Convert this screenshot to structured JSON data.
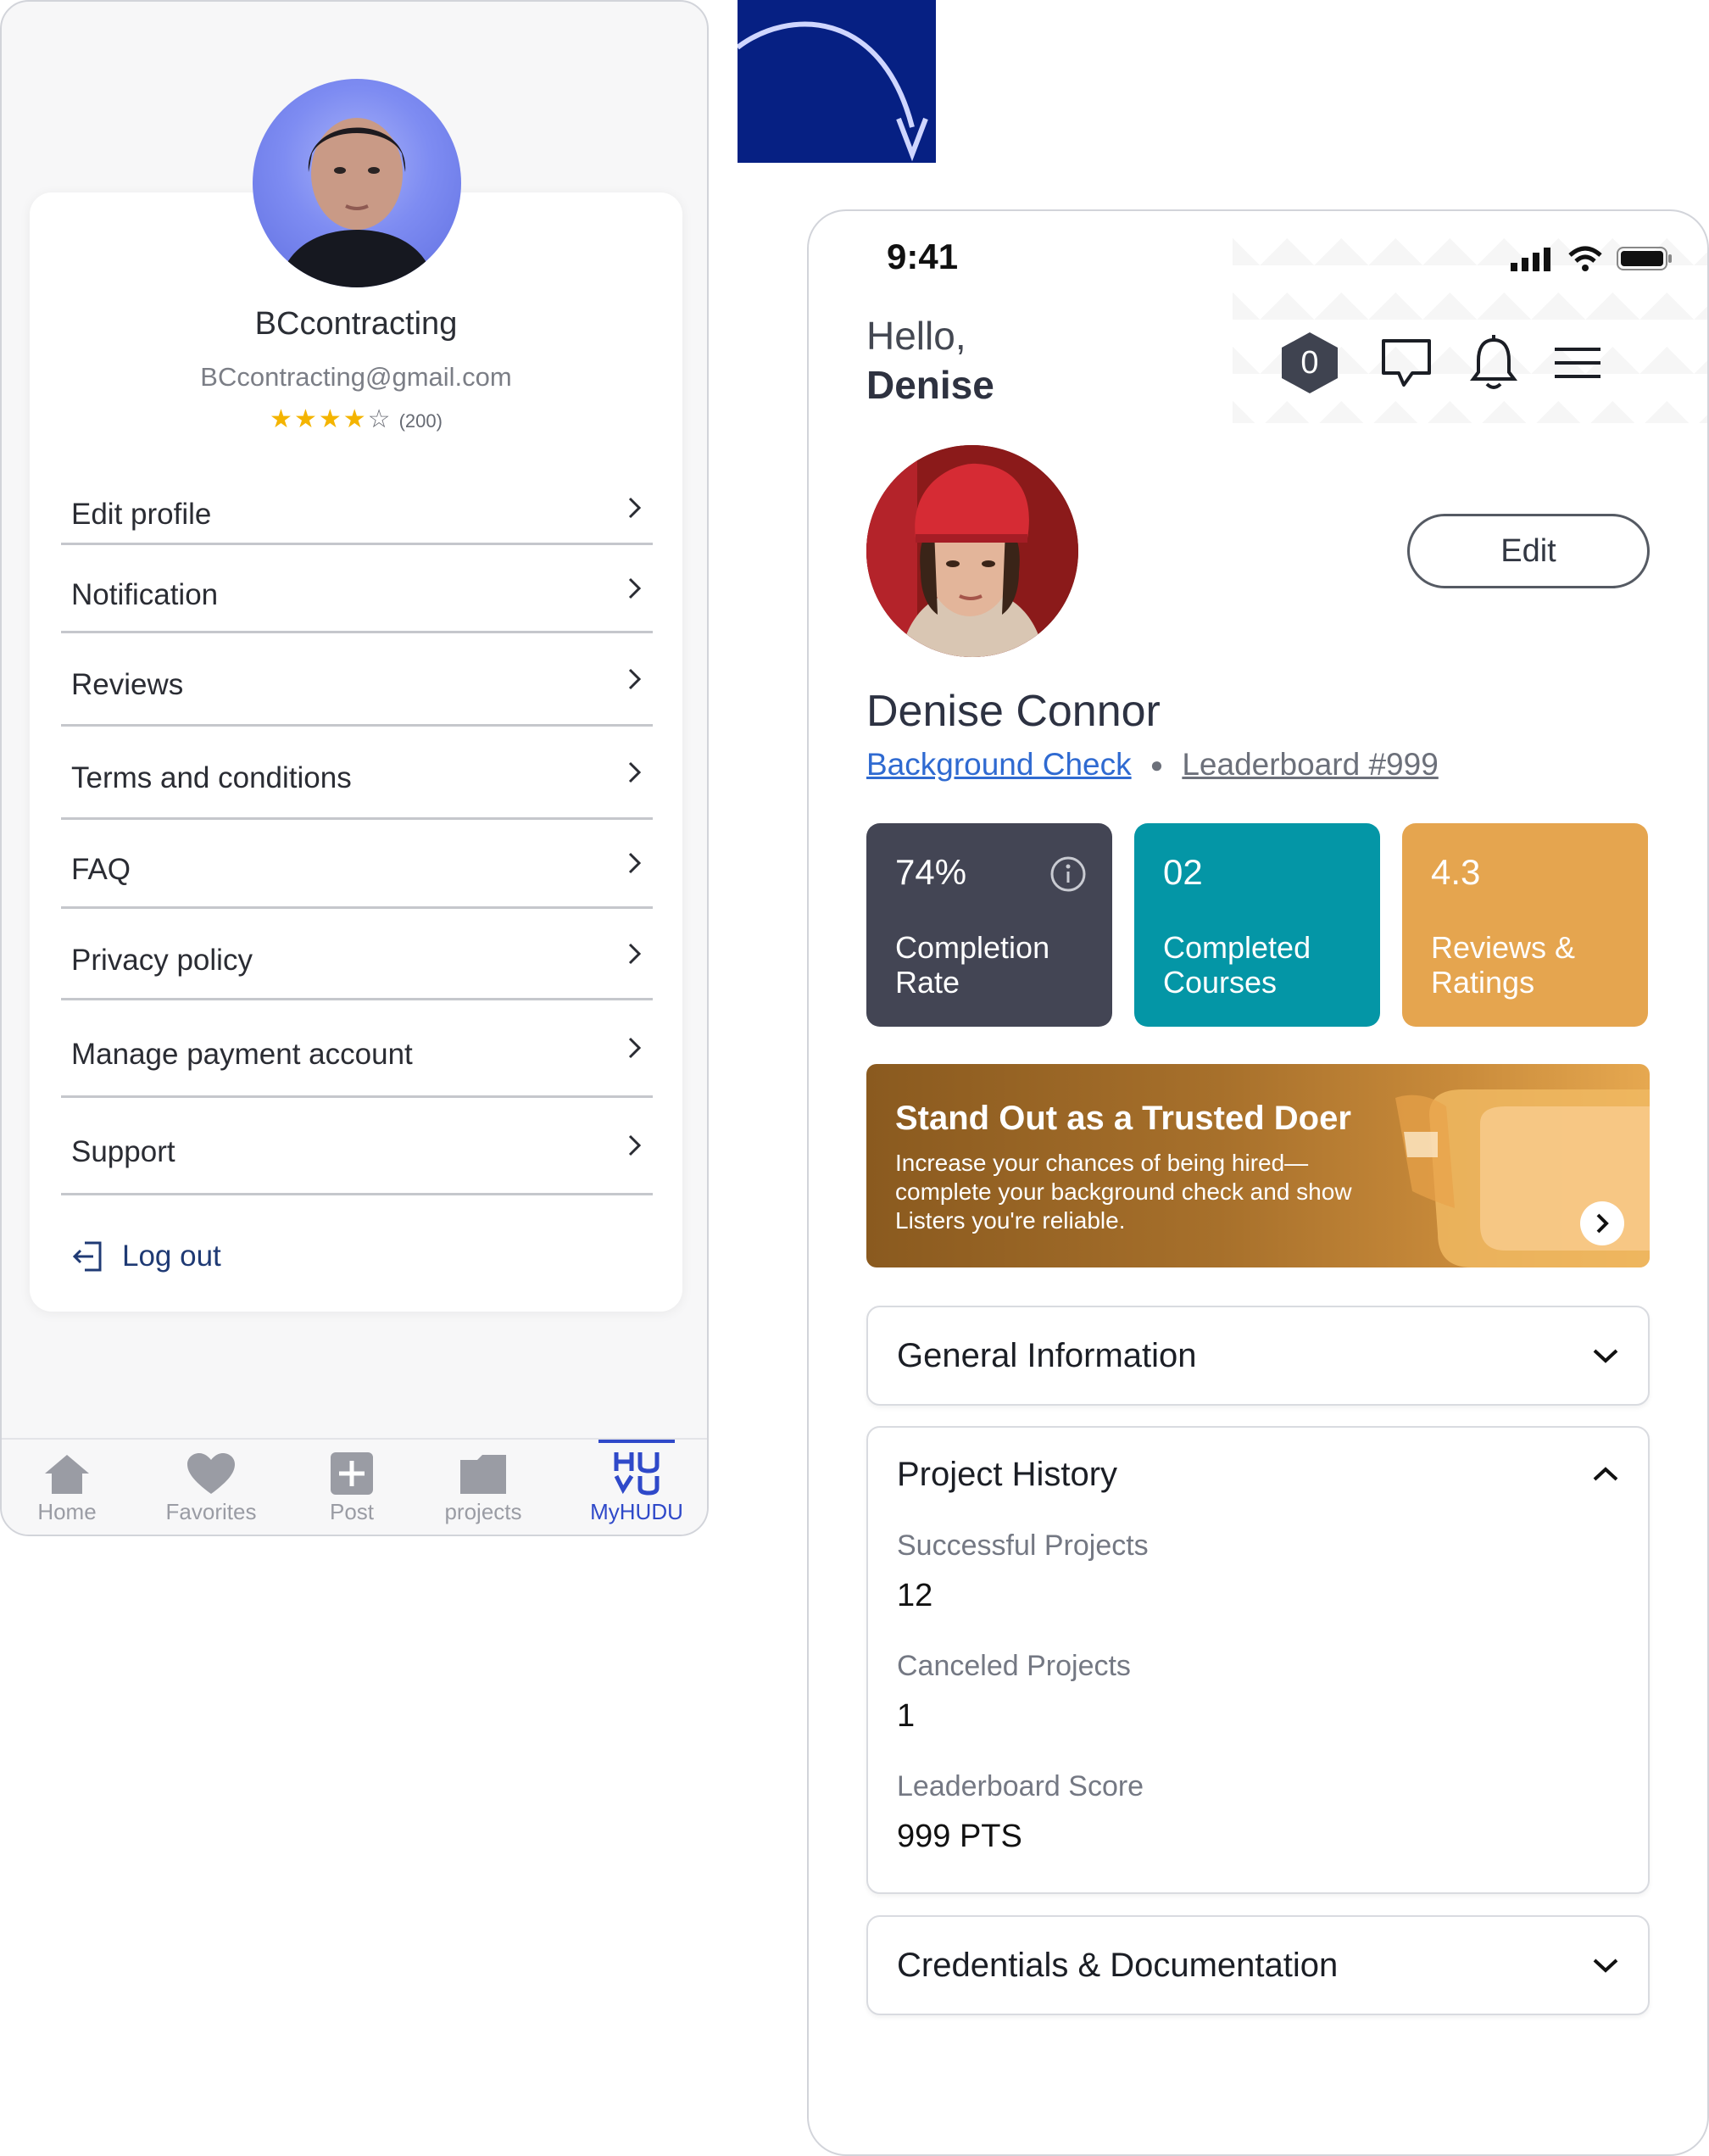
{
  "old_screen": {
    "profile": {
      "username": "BCcontracting",
      "email": "BCcontracting@gmail.com",
      "rating_stars": 4,
      "rating_max": 5,
      "rating_count": "(200)"
    },
    "menu": [
      {
        "label": "Edit profile"
      },
      {
        "label": "Notification"
      },
      {
        "label": "Reviews"
      },
      {
        "label": "Terms and conditions"
      },
      {
        "label": "FAQ"
      },
      {
        "label": "Privacy policy"
      },
      {
        "label": "Manage payment account"
      },
      {
        "label": "Support"
      }
    ],
    "logout_label": "Log out",
    "tabs": [
      {
        "label": "Home",
        "icon": "home-icon"
      },
      {
        "label": "Favorites",
        "icon": "heart-icon"
      },
      {
        "label": "Post",
        "icon": "plus-square-icon"
      },
      {
        "label": "projects",
        "icon": "folder-icon"
      },
      {
        "label": "MyHUDU",
        "icon": "hudu-logo-icon",
        "active": true
      }
    ],
    "hudu_logo_text": "HUDU"
  },
  "new_screen": {
    "status": {
      "time": "9:41"
    },
    "greeting": {
      "hello": "Hello,",
      "name": "Denise"
    },
    "badge_count": "0",
    "edit_label": "Edit",
    "full_name": "Denise Connor",
    "background_check_link": "Background Check",
    "leaderboard_link": "Leaderboard #999",
    "stats": [
      {
        "value": "74%",
        "label": "Completion Rate",
        "color": "#434554"
      },
      {
        "value": "02",
        "label": "Completed Courses",
        "color": "#0496a6"
      },
      {
        "value": "4.3",
        "label": "Reviews & Ratings",
        "color": "#e5a54f"
      }
    ],
    "promo": {
      "title": "Stand Out as a Trusted Doer",
      "body": "Increase your chances of being hired—complete your background check and show Listers you're reliable."
    },
    "sections": {
      "general": "General Information",
      "project_history": {
        "title": "Project History",
        "rows": [
          {
            "label": "Successful Projects",
            "value": "12"
          },
          {
            "label": "Canceled Projects",
            "value": "1"
          },
          {
            "label": "Leaderboard Score",
            "value": "999 PTS"
          }
        ]
      },
      "credentials": "Credentials & Documentation"
    }
  },
  "colors": {
    "accent_blue": "#2f49c9",
    "link_blue": "#2f6ad1",
    "arrow_box": "#062083"
  }
}
